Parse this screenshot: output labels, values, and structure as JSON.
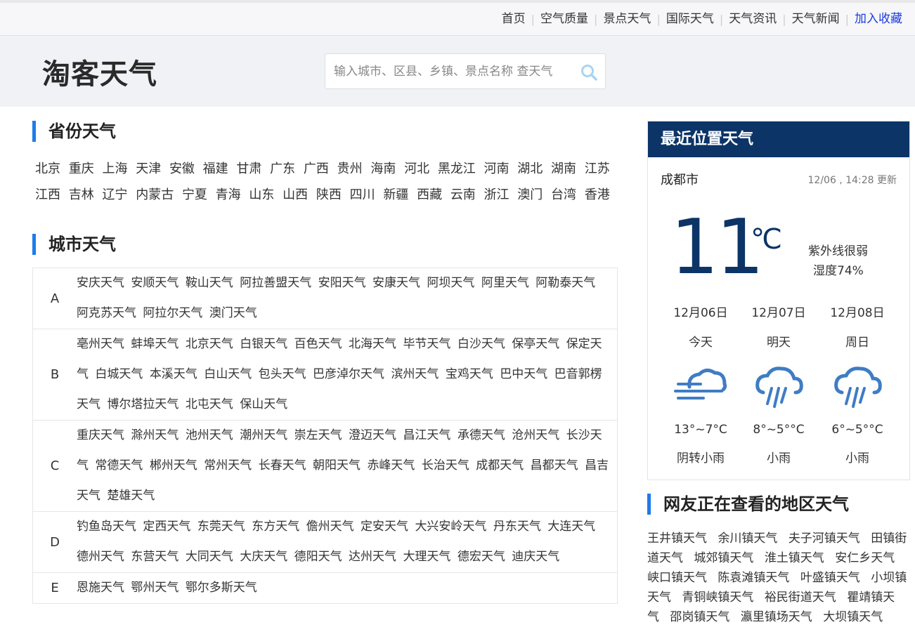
{
  "topnav": {
    "items": [
      "首页",
      "空气质量",
      "景点天气",
      "国际天气",
      "天气资讯",
      "天气新闻"
    ],
    "favorite": "加入收藏"
  },
  "header": {
    "logo": "淘客天气",
    "search_placeholder": "输入城市、区县、乡镇、景点名称 查天气"
  },
  "provinces": {
    "title": "省份天气",
    "items": [
      "北京",
      "重庆",
      "上海",
      "天津",
      "安徽",
      "福建",
      "甘肃",
      "广东",
      "广西",
      "贵州",
      "海南",
      "河北",
      "黑龙江",
      "河南",
      "湖北",
      "湖南",
      "江苏",
      "江西",
      "吉林",
      "辽宁",
      "内蒙古",
      "宁夏",
      "青海",
      "山东",
      "山西",
      "陕西",
      "四川",
      "新疆",
      "西藏",
      "云南",
      "浙江",
      "澳门",
      "台湾",
      "香港"
    ]
  },
  "cities": {
    "title": "城市天气",
    "rows": [
      {
        "letter": "A",
        "items": [
          "安庆天气",
          "安顺天气",
          "鞍山天气",
          "阿拉善盟天气",
          "安阳天气",
          "安康天气",
          "阿坝天气",
          "阿里天气",
          "阿勒泰天气",
          "阿克苏天气",
          "阿拉尔天气",
          "澳门天气"
        ]
      },
      {
        "letter": "B",
        "items": [
          "亳州天气",
          "蚌埠天气",
          "北京天气",
          "白银天气",
          "百色天气",
          "北海天气",
          "毕节天气",
          "白沙天气",
          "保亭天气",
          "保定天气",
          "白城天气",
          "本溪天气",
          "白山天气",
          "包头天气",
          "巴彦淖尔天气",
          "滨州天气",
          "宝鸡天气",
          "巴中天气",
          "巴音郭楞天气",
          "博尔塔拉天气",
          "北屯天气",
          "保山天气"
        ]
      },
      {
        "letter": "C",
        "items": [
          "重庆天气",
          "滁州天气",
          "池州天气",
          "潮州天气",
          "崇左天气",
          "澄迈天气",
          "昌江天气",
          "承德天气",
          "沧州天气",
          "长沙天气",
          "常德天气",
          "郴州天气",
          "常州天气",
          "长春天气",
          "朝阳天气",
          "赤峰天气",
          "长治天气",
          "成都天气",
          "昌都天气",
          "昌吉天气",
          "楚雄天气"
        ]
      },
      {
        "letter": "D",
        "items": [
          "钓鱼岛天气",
          "定西天气",
          "东莞天气",
          "东方天气",
          "儋州天气",
          "定安天气",
          "大兴安岭天气",
          "丹东天气",
          "大连天气",
          "德州天气",
          "东营天气",
          "大同天气",
          "大庆天气",
          "德阳天气",
          "达州天气",
          "大理天气",
          "德宏天气",
          "迪庆天气"
        ]
      },
      {
        "letter": "E",
        "items": [
          "恩施天气",
          "鄂州天气",
          "鄂尔多斯天气"
        ]
      }
    ]
  },
  "sidebar": {
    "title": "最近位置天气",
    "city": "成都市",
    "updated": "12/06 , 14:28 更新",
    "temp": "11",
    "unit": "℃",
    "uv": "紫外线很弱",
    "humidity": "湿度74%",
    "forecast": [
      {
        "date": "12月06日",
        "day": "今天",
        "icon": "fog-cloud-icon",
        "temp": "13°~7°C",
        "cond": "阴转小雨"
      },
      {
        "date": "12月07日",
        "day": "明天",
        "icon": "rain-cloud-icon",
        "temp": "8°~5°°C",
        "cond": "小雨"
      },
      {
        "date": "12月08日",
        "day": "周日",
        "icon": "rain-cloud-icon",
        "temp": "6°~5°°C",
        "cond": "小雨"
      }
    ],
    "icon_color": "#3f7cc4"
  },
  "viewing": {
    "title": "网友正在查看的地区天气",
    "items": [
      "王井镇天气",
      "余川镇天气",
      "夫子河镇天气",
      "田镇街道天气",
      "城郊镇天气",
      "淮土镇天气",
      "安仁乡天气",
      "峡口镇天气",
      "陈袁滩镇天气",
      "叶盛镇天气",
      "小坝镇天气",
      "青铜峡镇天气",
      "裕民街道天气",
      "瞿靖镇天气",
      "邵岗镇天气",
      "瀛里镇场天气",
      "大坝镇天气"
    ]
  }
}
